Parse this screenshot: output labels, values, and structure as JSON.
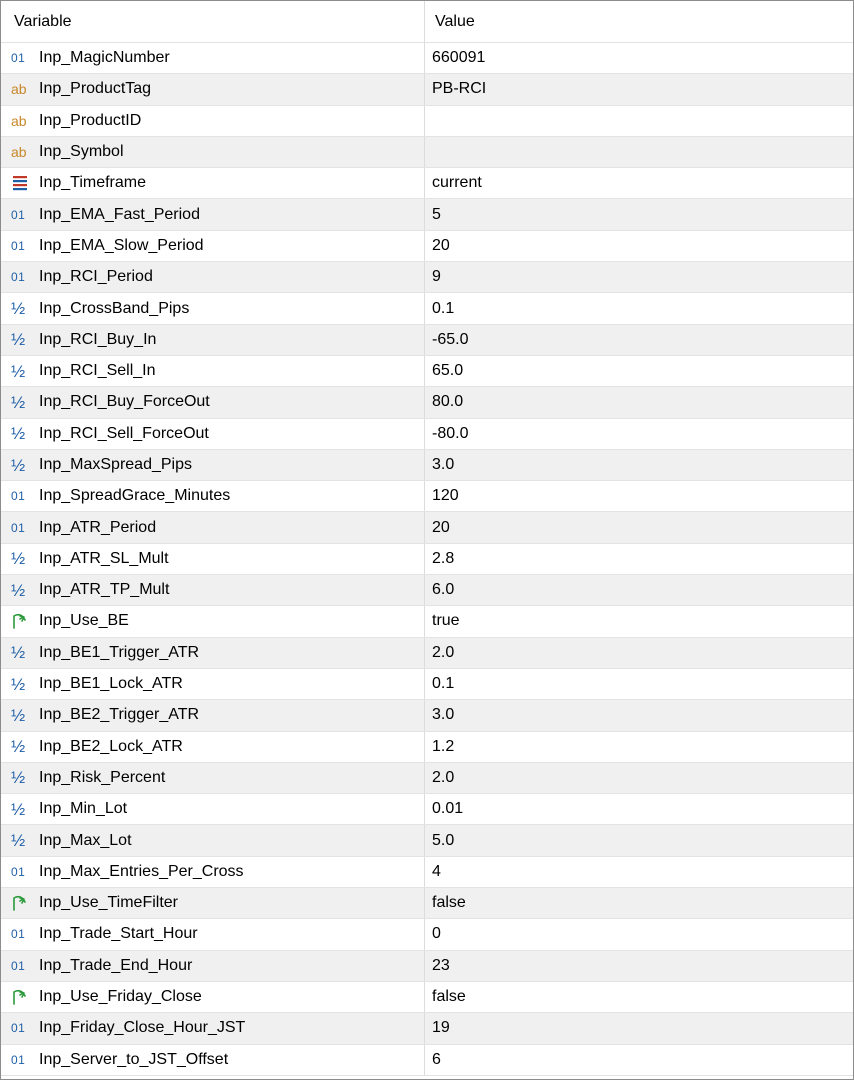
{
  "columns": {
    "variable": "Variable",
    "value": "Value"
  },
  "colors": {
    "int": "#1f5fa8",
    "string": "#c8872a",
    "double": "#1f5fa8",
    "bool": "#2a9a3a",
    "enum": "#c0392b"
  },
  "rows": [
    {
      "icon": "int-icon",
      "variable": "Inp_MagicNumber",
      "value": "660091"
    },
    {
      "icon": "string-icon",
      "variable": "Inp_ProductTag",
      "value": "PB-RCI"
    },
    {
      "icon": "string-icon",
      "variable": "Inp_ProductID",
      "value": ""
    },
    {
      "icon": "string-icon",
      "variable": "Inp_Symbol",
      "value": ""
    },
    {
      "icon": "enum-icon",
      "variable": "Inp_Timeframe",
      "value": "current"
    },
    {
      "icon": "int-icon",
      "variable": "Inp_EMA_Fast_Period",
      "value": "5"
    },
    {
      "icon": "int-icon",
      "variable": "Inp_EMA_Slow_Period",
      "value": "20"
    },
    {
      "icon": "int-icon",
      "variable": "Inp_RCI_Period",
      "value": "9"
    },
    {
      "icon": "double-icon",
      "variable": "Inp_CrossBand_Pips",
      "value": "0.1"
    },
    {
      "icon": "double-icon",
      "variable": "Inp_RCI_Buy_In",
      "value": "-65.0"
    },
    {
      "icon": "double-icon",
      "variable": "Inp_RCI_Sell_In",
      "value": "65.0"
    },
    {
      "icon": "double-icon",
      "variable": "Inp_RCI_Buy_ForceOut",
      "value": "80.0"
    },
    {
      "icon": "double-icon",
      "variable": "Inp_RCI_Sell_ForceOut",
      "value": "-80.0"
    },
    {
      "icon": "double-icon",
      "variable": "Inp_MaxSpread_Pips",
      "value": "3.0"
    },
    {
      "icon": "int-icon",
      "variable": "Inp_SpreadGrace_Minutes",
      "value": "120"
    },
    {
      "icon": "int-icon",
      "variable": "Inp_ATR_Period",
      "value": "20"
    },
    {
      "icon": "double-icon",
      "variable": "Inp_ATR_SL_Mult",
      "value": "2.8"
    },
    {
      "icon": "double-icon",
      "variable": "Inp_ATR_TP_Mult",
      "value": "6.0"
    },
    {
      "icon": "bool-icon",
      "variable": "Inp_Use_BE",
      "value": "true"
    },
    {
      "icon": "double-icon",
      "variable": "Inp_BE1_Trigger_ATR",
      "value": "2.0"
    },
    {
      "icon": "double-icon",
      "variable": "Inp_BE1_Lock_ATR",
      "value": "0.1"
    },
    {
      "icon": "double-icon",
      "variable": "Inp_BE2_Trigger_ATR",
      "value": "3.0"
    },
    {
      "icon": "double-icon",
      "variable": "Inp_BE2_Lock_ATR",
      "value": "1.2"
    },
    {
      "icon": "double-icon",
      "variable": "Inp_Risk_Percent",
      "value": "2.0"
    },
    {
      "icon": "double-icon",
      "variable": "Inp_Min_Lot",
      "value": "0.01"
    },
    {
      "icon": "double-icon",
      "variable": "Inp_Max_Lot",
      "value": "5.0"
    },
    {
      "icon": "int-icon",
      "variable": "Inp_Max_Entries_Per_Cross",
      "value": "4"
    },
    {
      "icon": "bool-icon",
      "variable": "Inp_Use_TimeFilter",
      "value": "false"
    },
    {
      "icon": "int-icon",
      "variable": "Inp_Trade_Start_Hour",
      "value": "0"
    },
    {
      "icon": "int-icon",
      "variable": "Inp_Trade_End_Hour",
      "value": "23"
    },
    {
      "icon": "bool-icon",
      "variable": "Inp_Use_Friday_Close",
      "value": "false"
    },
    {
      "icon": "int-icon",
      "variable": "Inp_Friday_Close_Hour_JST",
      "value": "19"
    },
    {
      "icon": "int-icon",
      "variable": "Inp_Server_to_JST_Offset",
      "value": "6"
    }
  ]
}
